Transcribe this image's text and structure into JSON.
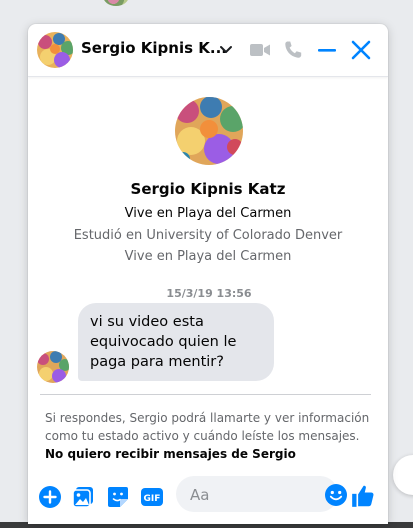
{
  "header": {
    "contact_name": "Sergio Kipnis K..."
  },
  "profile": {
    "name": "Sergio Kipnis Katz",
    "lines": [
      "Vive en Playa del Carmen",
      "Estudió en University of Colorado Denver",
      "Vive en Playa del Carmen"
    ]
  },
  "conversation": {
    "timestamp": "15/3/19 13:56",
    "message_lines": [
      "vi su video esta",
      "equivocado quien le",
      "paga para mentir?"
    ]
  },
  "notice": {
    "text": "Si respondes, Sergio podrá llamarte y ver información como tu estado activo y cuándo leíste los mensajes. ",
    "link_label": "No quiero recibir mensajes de Sergio"
  },
  "composer": {
    "placeholder": "Aa"
  },
  "colors": {
    "accent": "#0084ff",
    "disabled_icon": "#bcc0c4",
    "bubble": "#e4e6eb"
  },
  "icons": {
    "header": [
      "chevron-down-icon",
      "video-call-icon",
      "phone-call-icon",
      "minimize-icon",
      "close-icon"
    ],
    "composer": [
      "plus-icon",
      "photo-icon",
      "sticker-icon",
      "gif-icon",
      "emoji-icon",
      "like-icon"
    ]
  }
}
